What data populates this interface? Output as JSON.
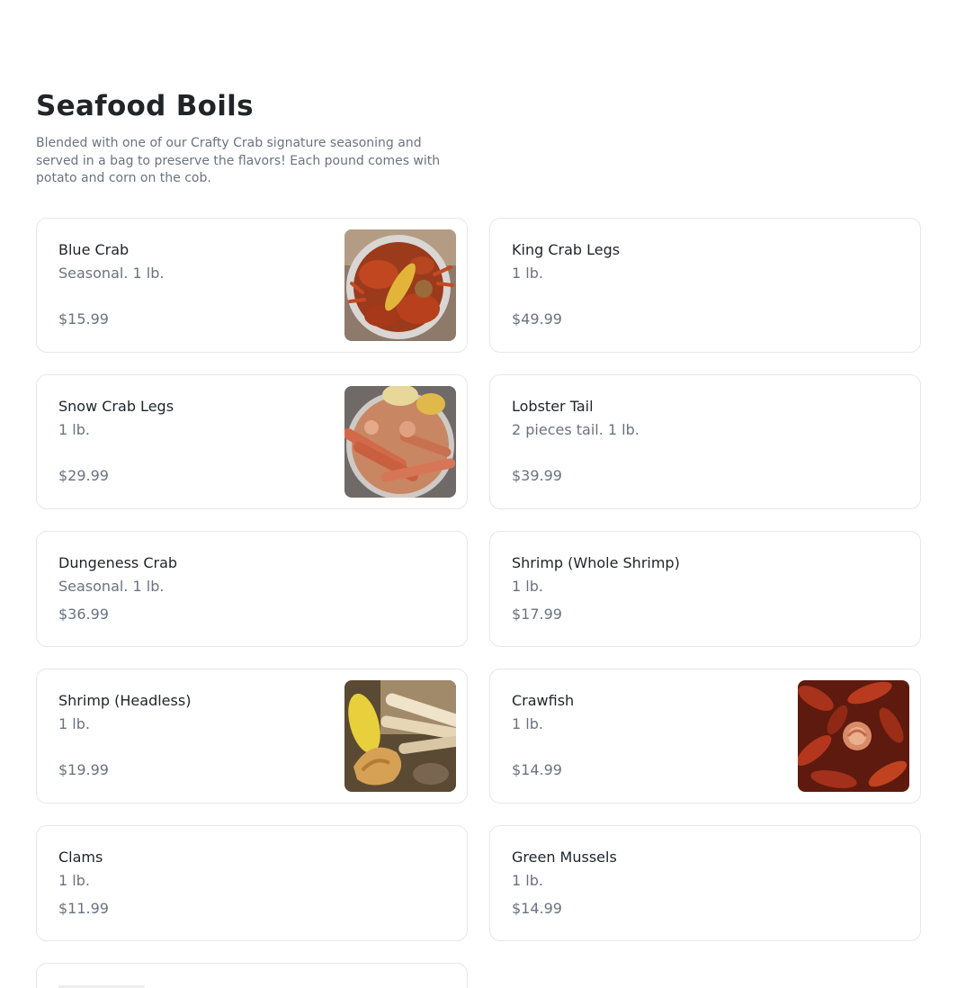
{
  "section": {
    "title": "Seafood Boils",
    "description": "Blended with one of our Crafty Crab signature seasoning and served in a bag to preserve the flavors! Each pound comes with potato and corn on the cob."
  },
  "items": [
    {
      "name": "Blue Crab",
      "description": "Seasonal. 1 lb.",
      "price": "$15.99",
      "image": "blue-crab-photo"
    },
    {
      "name": "King Crab Legs",
      "description": "1 lb.",
      "price": "$49.99",
      "image": null
    },
    {
      "name": "Snow Crab Legs",
      "description": "1 lb.",
      "price": "$29.99",
      "image": "snow-crab-legs-photo"
    },
    {
      "name": "Lobster Tail",
      "description": "2 pieces tail. 1 lb.",
      "price": "$39.99",
      "image": null
    },
    {
      "name": "Dungeness Crab",
      "description": "Seasonal. 1 lb.",
      "price": "$36.99",
      "image": null
    },
    {
      "name": "Shrimp (Whole Shrimp)",
      "description": "1 lb.",
      "price": "$17.99",
      "image": null
    },
    {
      "name": "Shrimp (Headless)",
      "description": "1 lb.",
      "price": "$19.99",
      "image": "shrimp-headless-photo"
    },
    {
      "name": "Crawfish",
      "description": "1 lb.",
      "price": "$14.99",
      "image": "crawfish-photo"
    },
    {
      "name": "Clams",
      "description": "1 lb.",
      "price": "$11.99",
      "image": null
    },
    {
      "name": "Green Mussels",
      "description": "1 lb.",
      "price": "$14.99",
      "image": null
    }
  ],
  "colors": {
    "border": "#e5e7eb",
    "muted_text": "#6b7280",
    "title_text": "#222427"
  }
}
